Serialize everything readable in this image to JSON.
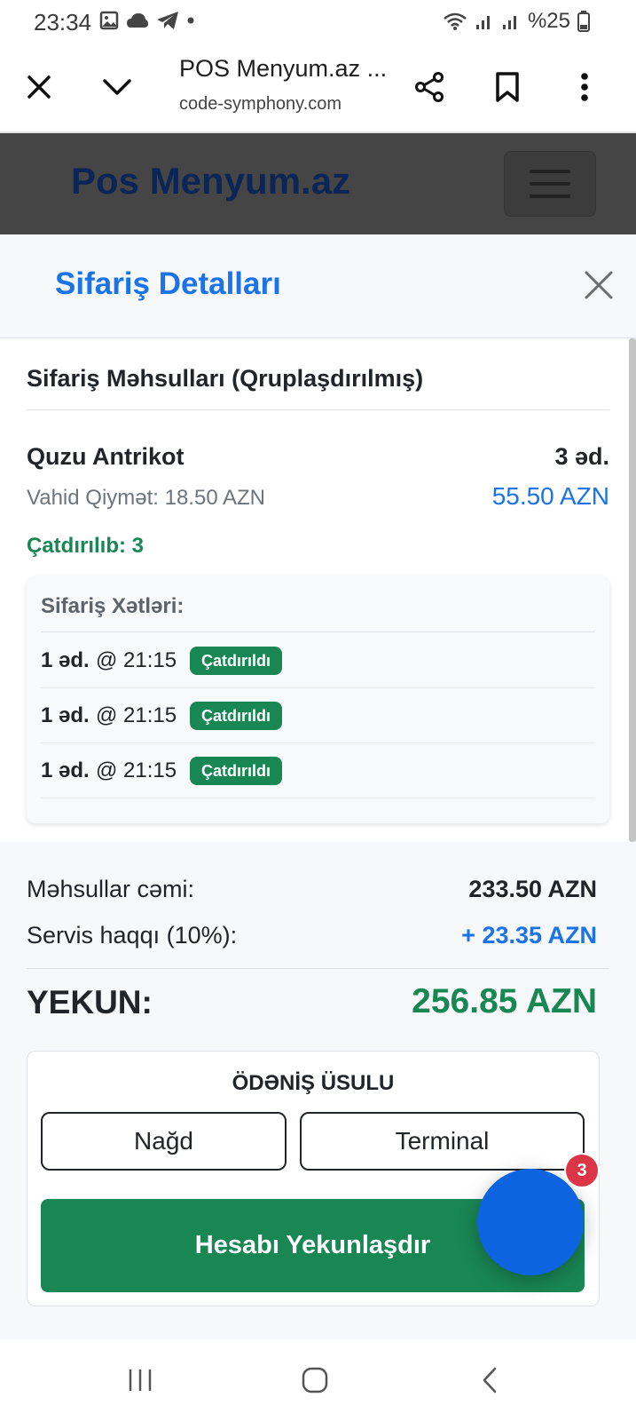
{
  "status_bar": {
    "time": "23:34",
    "battery": "%25"
  },
  "browser": {
    "page_title": "POS Menyum.az ...",
    "url": "code-symphony.com"
  },
  "navbar": {
    "brand": "Pos Menyum.az"
  },
  "modal": {
    "title": "Sifariş Detalları",
    "section_title": "Sifariş Məhsulları (Qruplaşdırılmış)",
    "product": {
      "name": "Quzu Antrikot",
      "quantity": "3 əd.",
      "unit_price": "Vahid Qiymət: 18.50 AZN",
      "line_total": "55.50 AZN",
      "delivered": "Çatdırılıb: 3"
    },
    "order_lines": {
      "title": "Sifariş Xətləri:",
      "items": [
        {
          "qty": "1 əd.",
          "time": "@ 21:15",
          "status": "Çatdırıldı"
        },
        {
          "qty": "1 əd.",
          "time": "@ 21:15",
          "status": "Çatdırıldı"
        },
        {
          "qty": "1 əd.",
          "time": "@ 21:15",
          "status": "Çatdırıldı"
        }
      ]
    }
  },
  "summary": {
    "products_total_label": "Məhsullar cəmi:",
    "products_total_value": "233.50 AZN",
    "service_fee_label": "Servis haqqı (10%):",
    "service_fee_value": "+ 23.35 AZN",
    "total_label": "YEKUN:",
    "total_value": "256.85 AZN"
  },
  "payment": {
    "title": "ÖDƏNİŞ ÜSULU",
    "cash_label": "Nağd",
    "terminal_label": "Terminal",
    "finish_label": "Hesabı Yekunlaşdır"
  },
  "fab": {
    "badge_count": "3"
  },
  "colors": {
    "primary_blue": "#1a73e8",
    "success_green": "#198754",
    "navbar_bg": "#454545",
    "brand_text": "#0b2556",
    "fab_blue": "#0d63e0",
    "badge_red": "#dc3545"
  }
}
